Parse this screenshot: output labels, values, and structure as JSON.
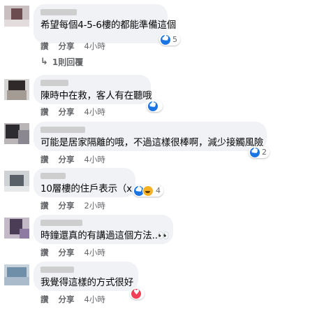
{
  "comments": [
    {
      "text": "希望每個4-5-6樓的都能準備這個",
      "reaction_count": "5",
      "actions": [
        "讚",
        "分享"
      ],
      "time": "4小時",
      "replies": "1則回覆"
    },
    {
      "text": "陳時中在救，客人有在聽哦",
      "reaction_count": "",
      "actions": [
        "讚",
        "分享"
      ],
      "time": "4小時"
    },
    {
      "text": "可能是居家隔離的哦，不過這樣很棒啊，減少接觸風險",
      "reaction_count": "2",
      "actions": [
        "讚",
        "分享"
      ],
      "time": "4小時"
    },
    {
      "text": "10層樓的住戶表示（x",
      "reaction_count": "4",
      "actions": [
        "讚",
        "分享"
      ],
      "time": "2小時"
    },
    {
      "text": "時鐘還真的有講過這個方法..👀",
      "reaction_count": "",
      "actions": [
        "讚",
        "分享"
      ],
      "time": "4小時"
    },
    {
      "text": "我覺得這樣的方式很好",
      "reaction_count": "",
      "actions": [
        "讚",
        "分享"
      ],
      "time": "4小時"
    }
  ],
  "icons": {
    "like": "like-icon",
    "haha": "haha-icon",
    "love": "love-icon",
    "reply": "reply-arrow-icon"
  },
  "colors": {
    "bubble": "#f0f2f5",
    "like": "#1b74e4",
    "love": "#f33e58",
    "meta": "#65676b"
  }
}
